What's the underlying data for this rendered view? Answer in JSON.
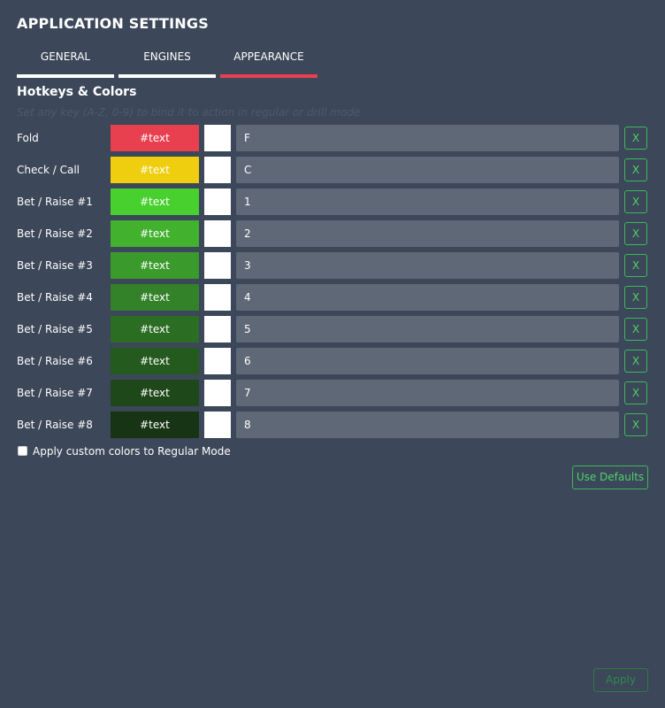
{
  "window": {
    "title": "APPLICATION SETTINGS"
  },
  "tabs": [
    {
      "label": "GENERAL",
      "active": false
    },
    {
      "label": "ENGINES",
      "active": false
    },
    {
      "label": "APPEARANCE",
      "active": true
    }
  ],
  "section": {
    "title": "Hotkeys & Colors",
    "hint": "Set any key (A-Z, 0-9) to bind it to action in regular or drill mode"
  },
  "actions": [
    {
      "label": "Fold",
      "color_text": "#text",
      "color": "#e8404f",
      "key": "F",
      "clear_label": "X"
    },
    {
      "label": "Check / Call",
      "color_text": "#text",
      "color": "#efce0f",
      "key": "C",
      "clear_label": "X"
    },
    {
      "label": "Bet / Raise #1",
      "color_text": "#text",
      "color": "#48d02e",
      "key": "1",
      "clear_label": "X"
    },
    {
      "label": "Bet / Raise #2",
      "color_text": "#text",
      "color": "#41b12e",
      "key": "2",
      "clear_label": "X"
    },
    {
      "label": "Bet / Raise #3",
      "color_text": "#text",
      "color": "#3a9a2b",
      "key": "3",
      "clear_label": "X"
    },
    {
      "label": "Bet / Raise #4",
      "color_text": "#text",
      "color": "#33822a",
      "key": "4",
      "clear_label": "X"
    },
    {
      "label": "Bet / Raise #5",
      "color_text": "#text",
      "color": "#2c6d24",
      "key": "5",
      "clear_label": "X"
    },
    {
      "label": "Bet / Raise #6",
      "color_text": "#text",
      "color": "#255a1f",
      "key": "6",
      "clear_label": "X"
    },
    {
      "label": "Bet / Raise #7",
      "color_text": "#text",
      "color": "#1e481a",
      "key": "7",
      "clear_label": "X"
    },
    {
      "label": "Bet / Raise #8",
      "color_text": "#text",
      "color": "#173514",
      "key": "8",
      "clear_label": "X"
    }
  ],
  "options": {
    "custom_colors_label": "Apply custom colors to Regular Mode",
    "custom_colors_checked": false
  },
  "buttons": {
    "use_defaults": "Use Defaults",
    "apply": "Apply"
  }
}
